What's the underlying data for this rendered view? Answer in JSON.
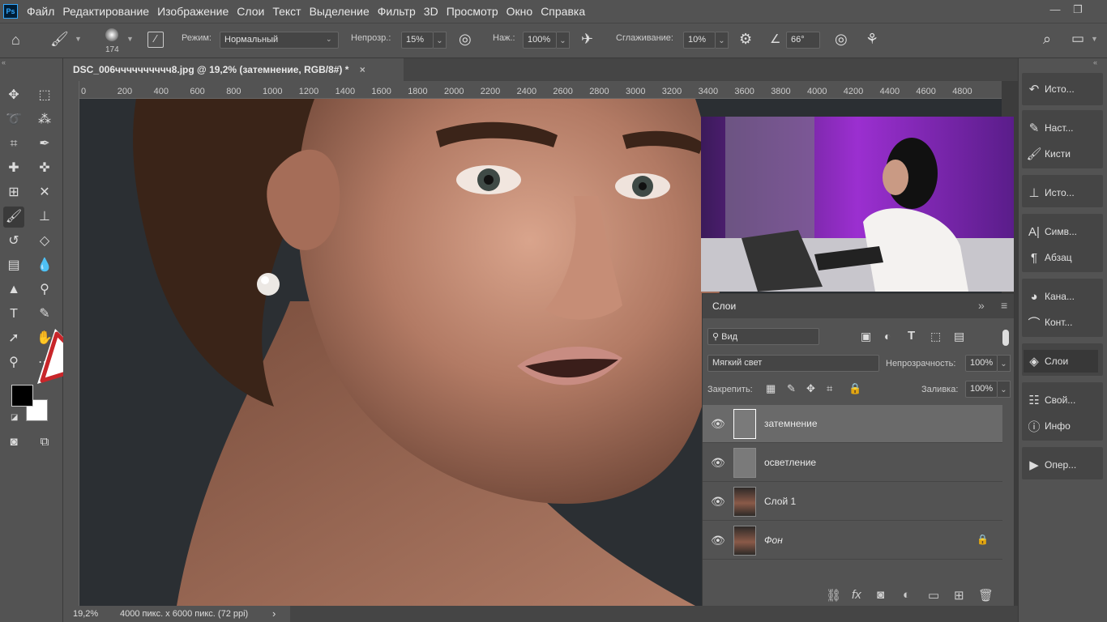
{
  "app": {
    "logo": "Ps"
  },
  "menu": [
    "Файл",
    "Редактирование",
    "Изображение",
    "Слои",
    "Текст",
    "Выделение",
    "Фильтр",
    "3D",
    "Просмотр",
    "Окно",
    "Справка"
  ],
  "window_controls": {
    "minimize": "—",
    "restore": "❐"
  },
  "options": {
    "brush_size": "174",
    "mode_label": "Режим:",
    "mode_value": "Нормальный",
    "opacity_label": "Непрозр.:",
    "opacity_value": "15%",
    "pressure_label": "Наж.:",
    "pressure_value": "100%",
    "smoothing_label": "Сглаживание:",
    "smoothing_value": "10%",
    "angle_value": "66°"
  },
  "document": {
    "tab_title": "DSC_006чччччччччч8.jpg @ 19,2% (затемнение, RGB/8#) *",
    "close": "×"
  },
  "ruler_ticks": [
    "0",
    "200",
    "400",
    "600",
    "800",
    "1000",
    "1200",
    "1400",
    "1600",
    "1800",
    "2000",
    "2200",
    "2400",
    "2600",
    "2800",
    "3000",
    "3200",
    "3400",
    "3600",
    "3800",
    "4000",
    "4200",
    "4400",
    "4600",
    "4800"
  ],
  "status": {
    "zoom": "19,2%",
    "info": "4000 пикс. x 6000 пикс. (72 ppi)",
    "arrow": "›"
  },
  "dock": [
    {
      "label": "Исто...",
      "icon": "history-icon"
    },
    {
      "label": "Наст...",
      "icon": "brush-settings-icon"
    },
    {
      "label": "Кисти",
      "icon": "brushes-icon"
    },
    {
      "label": "Исто...",
      "icon": "clone-source-icon"
    },
    {
      "label": "Симв...",
      "icon": "character-icon"
    },
    {
      "label": "Абзац",
      "icon": "paragraph-icon"
    },
    {
      "label": "Кана...",
      "icon": "channels-icon"
    },
    {
      "label": "Конт...",
      "icon": "paths-icon"
    },
    {
      "label": "Слои",
      "icon": "layers-icon"
    },
    {
      "label": "Свой...",
      "icon": "properties-icon"
    },
    {
      "label": "Инфо",
      "icon": "info-icon"
    },
    {
      "label": "Опер...",
      "icon": "actions-icon"
    }
  ],
  "layers_panel": {
    "title": "Слои",
    "filter_value": "Вид",
    "blend_mode": "Мягкий свет",
    "opacity_label": "Непрозрачность:",
    "opacity_value": "100%",
    "lock_label": "Закрепить:",
    "fill_label": "Заливка:",
    "fill_value": "100%",
    "layers": [
      {
        "name": "затемнение",
        "selected": true
      },
      {
        "name": "осветление",
        "selected": false
      },
      {
        "name": "Слой 1",
        "selected": false
      },
      {
        "name": "Фон",
        "selected": false,
        "locked": true
      }
    ]
  },
  "colors": {
    "foreground": "#000000",
    "background": "#ffffff",
    "arrow_annotation": "#c8262a"
  }
}
